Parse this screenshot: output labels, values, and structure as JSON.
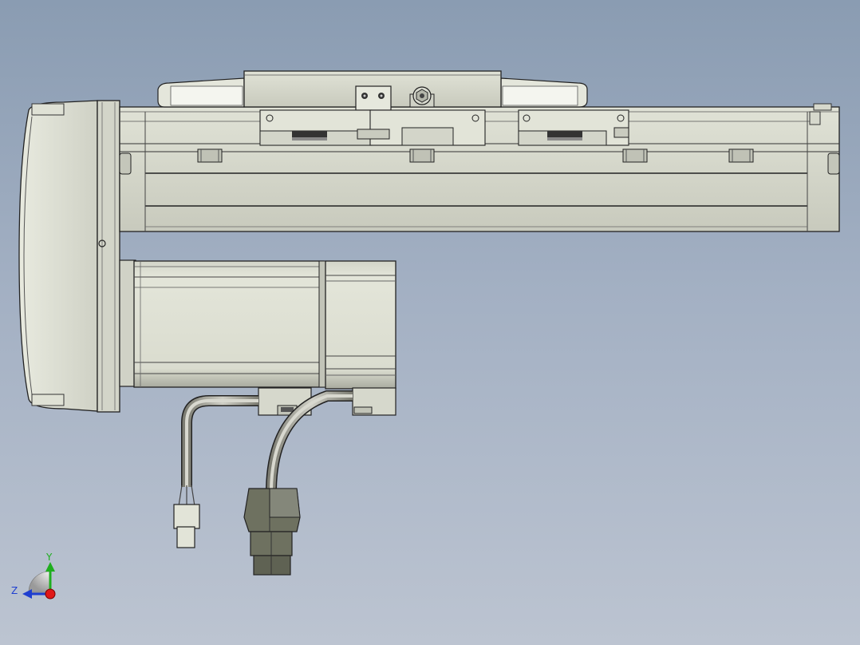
{
  "viewport": {
    "background_top": "#8a9cb2",
    "background_bottom": "#bcc4d1",
    "part_color": "#d6d8cc",
    "part_shadow": "#b9bbb0",
    "edge_color": "#1f1f1f",
    "connector_color": "#6e7160",
    "cable_color": "#9c9c90"
  },
  "triad": {
    "y_label": "Y",
    "z_label": "Z",
    "y_color": "#1fae1f",
    "z_color": "#1f3fd0",
    "x_color": "#e01818"
  }
}
